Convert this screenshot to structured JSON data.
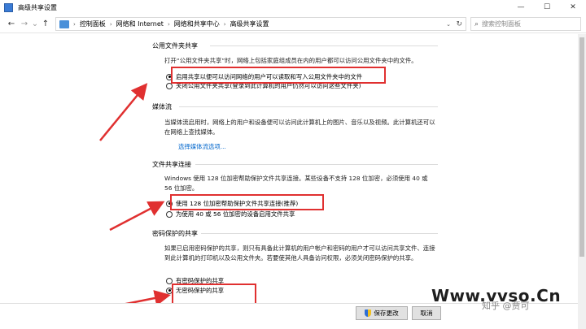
{
  "window": {
    "title": "高级共享设置",
    "minimize": "—",
    "maximize": "☐",
    "close": "✕"
  },
  "nav": {
    "back": "←",
    "forward": "→",
    "recent": "⌄",
    "up": "↑",
    "breadcrumbs": [
      "控制面板",
      "网络和 Internet",
      "网络和共享中心",
      "高级共享设置"
    ],
    "crumb_sep": "›",
    "dropdown": "⌄",
    "refresh": "↻",
    "search_placeholder": "搜索控制面板"
  },
  "sections": {
    "public_folder": {
      "title": "公用文件夹共享",
      "desc": "打开“公用文件夹共享”时，网络上包括家庭组成员在内的用户都可以访问公用文件夹中的文件。",
      "opt_on": "启用共享以便可以访问网络的用户可以读取和写入公用文件夹中的文件",
      "opt_off": "关闭公用文件夹共享(登录到此计算机的用户仍然可以访问这些文件夹)"
    },
    "media": {
      "title": "媒体流",
      "desc": "当媒体流启用时，网络上的用户和设备便可以访问此计算机上的图片、音乐以及视频。此计算机还可以在网络上查找媒体。",
      "link": "选择媒体流选项..."
    },
    "file_sharing": {
      "title": "文件共享连接",
      "desc": "Windows 使用 128 位加密帮助保护文件共享连接。某些设备不支持 128 位加密，必须使用 40 或 56 位加密。",
      "opt_128": "使用 128 位加密帮助保护文件共享连接(推荐)",
      "opt_40": "为使用 40 或 56 位加密的设备启用文件共享"
    },
    "password": {
      "title": "密码保护的共享",
      "desc": "如果已启用密码保护的共享，则只有具备此计算机的用户帐户和密码的用户才可以访问共享文件、连接到此计算机的打印机以及公用文件夹。若要使其他人具备访问权限，必须关闭密码保护的共享。",
      "opt_on": "有密码保护的共享",
      "opt_off": "无密码保护的共享"
    }
  },
  "buttons": {
    "save": "保存更改",
    "cancel": "取消"
  },
  "watermark": {
    "site": "Www.vvso.Cn",
    "zhihu": "知乎 @贾可"
  },
  "colors": {
    "highlight": "#e03030",
    "link": "#0066cc"
  }
}
